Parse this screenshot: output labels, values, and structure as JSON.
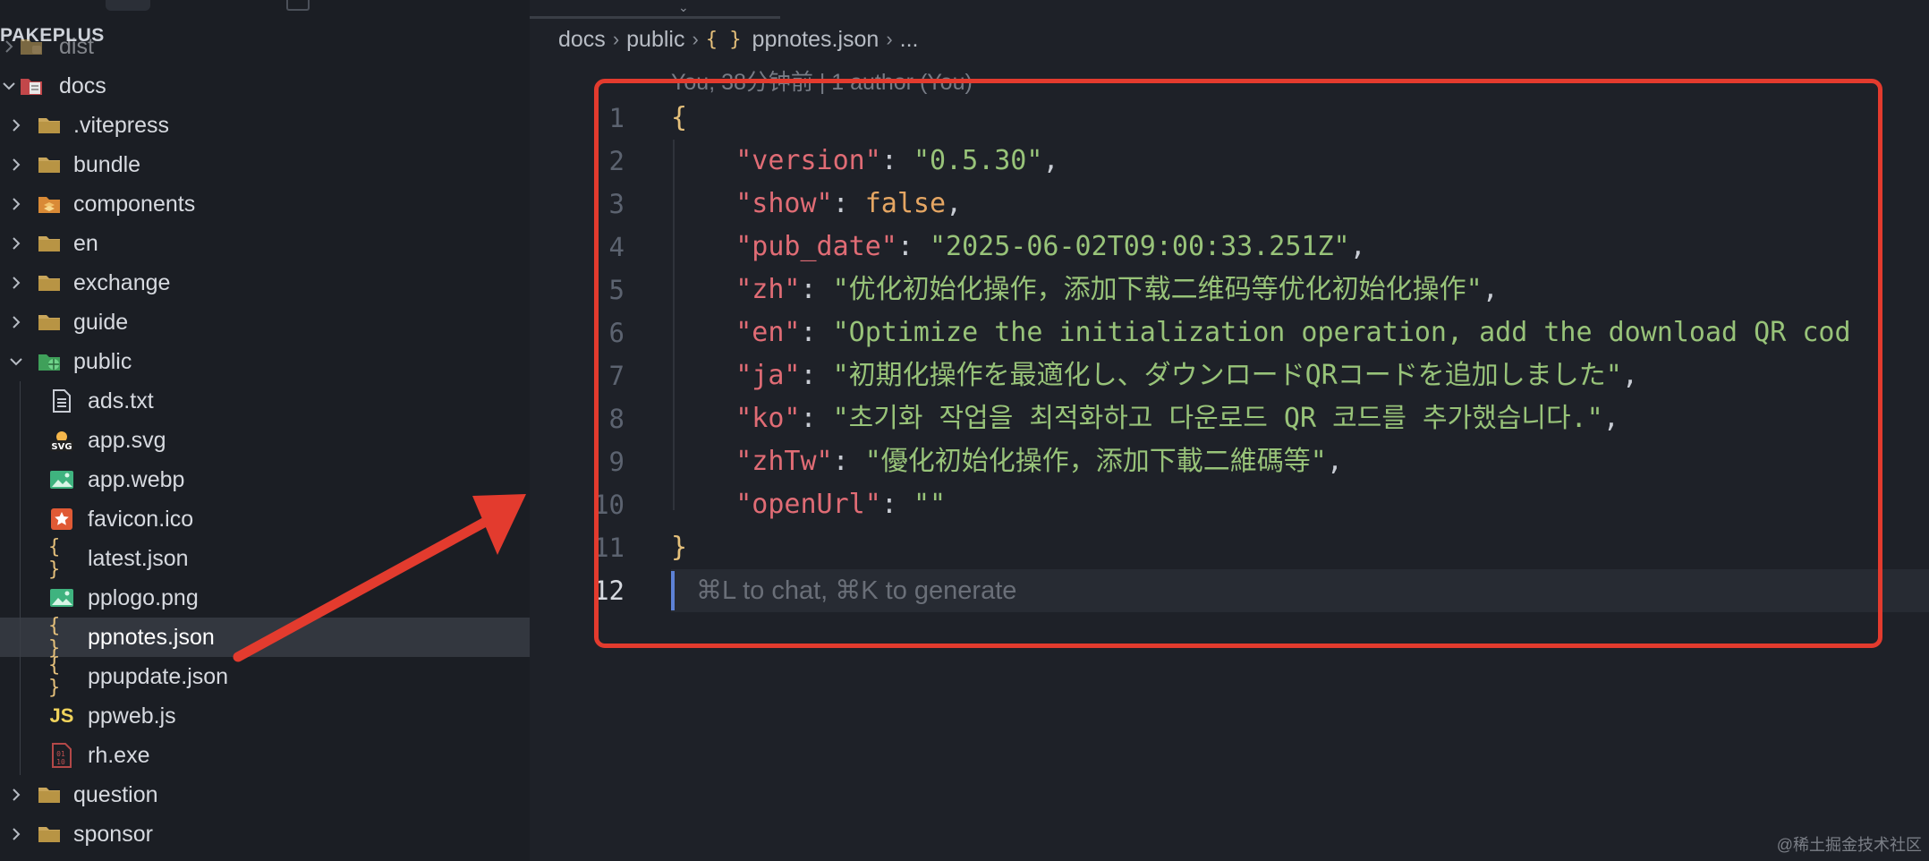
{
  "sidebar": {
    "section_title": "PAKEPLUS",
    "items": [
      {
        "label": "dist",
        "icon": "folder-dist-icon",
        "kind": "folder",
        "level": 0,
        "state": "collapsed"
      },
      {
        "label": "docs",
        "icon": "folder-docs-icon",
        "kind": "folder",
        "level": 0,
        "state": "expanded"
      },
      {
        "label": ".vitepress",
        "icon": "folder-icon",
        "kind": "folder",
        "level": 1,
        "state": "collapsed"
      },
      {
        "label": "bundle",
        "icon": "folder-icon",
        "kind": "folder",
        "level": 1,
        "state": "collapsed"
      },
      {
        "label": "components",
        "icon": "folder-components-icon",
        "kind": "folder",
        "level": 1,
        "state": "collapsed"
      },
      {
        "label": "en",
        "icon": "folder-icon",
        "kind": "folder",
        "level": 1,
        "state": "collapsed"
      },
      {
        "label": "exchange",
        "icon": "folder-icon",
        "kind": "folder",
        "level": 1,
        "state": "collapsed"
      },
      {
        "label": "guide",
        "icon": "folder-icon",
        "kind": "folder",
        "level": 1,
        "state": "collapsed"
      },
      {
        "label": "public",
        "icon": "folder-public-icon",
        "kind": "folder",
        "level": 1,
        "state": "expanded"
      },
      {
        "label": "ads.txt",
        "icon": "text-file-icon",
        "kind": "file",
        "level": 2
      },
      {
        "label": "app.svg",
        "icon": "svg-file-icon",
        "kind": "file",
        "level": 2
      },
      {
        "label": "app.webp",
        "icon": "image-file-icon",
        "kind": "file",
        "level": 2
      },
      {
        "label": "favicon.ico",
        "icon": "favicon-file-icon",
        "kind": "file",
        "level": 2
      },
      {
        "label": "latest.json",
        "icon": "json-file-icon",
        "kind": "file",
        "level": 2
      },
      {
        "label": "pplogo.png",
        "icon": "image-file-icon",
        "kind": "file",
        "level": 2
      },
      {
        "label": "ppnotes.json",
        "icon": "json-file-icon",
        "kind": "file",
        "level": 2,
        "selected": true
      },
      {
        "label": "ppupdate.json",
        "icon": "json-file-icon",
        "kind": "file",
        "level": 2
      },
      {
        "label": "ppweb.js",
        "icon": "js-file-icon",
        "kind": "file",
        "level": 2
      },
      {
        "label": "rh.exe",
        "icon": "binary-file-icon",
        "kind": "file",
        "level": 2
      },
      {
        "label": "question",
        "icon": "folder-icon",
        "kind": "folder",
        "level": 1,
        "state": "collapsed"
      },
      {
        "label": "sponsor",
        "icon": "folder-icon",
        "kind": "folder",
        "level": 1,
        "state": "collapsed"
      }
    ]
  },
  "breadcrumb": {
    "parts": [
      "docs",
      "public",
      "ppnotes.json",
      "..."
    ],
    "file_icon_glyph": "{ }"
  },
  "editor": {
    "blame": "You, 38分钟前 | 1 author (You)",
    "active_line": 12,
    "hint": "⌘L to chat, ⌘K to generate",
    "lines": [
      {
        "n": "1",
        "tokens": [
          {
            "t": "{",
            "c": "brace"
          }
        ]
      },
      {
        "n": "2",
        "tokens": [
          {
            "t": "    "
          },
          {
            "t": "\"version\"",
            "c": "key"
          },
          {
            "t": ": ",
            "c": "punc"
          },
          {
            "t": "\"0.5.30\"",
            "c": "str"
          },
          {
            "t": ",",
            "c": "punc"
          }
        ]
      },
      {
        "n": "3",
        "tokens": [
          {
            "t": "    "
          },
          {
            "t": "\"show\"",
            "c": "key"
          },
          {
            "t": ": ",
            "c": "punc"
          },
          {
            "t": "false",
            "c": "bool"
          },
          {
            "t": ",",
            "c": "punc"
          }
        ]
      },
      {
        "n": "4",
        "tokens": [
          {
            "t": "    "
          },
          {
            "t": "\"pub_date\"",
            "c": "key"
          },
          {
            "t": ": ",
            "c": "punc"
          },
          {
            "t": "\"2025-06-02T09:00:33.251Z\"",
            "c": "str"
          },
          {
            "t": ",",
            "c": "punc"
          }
        ]
      },
      {
        "n": "5",
        "tokens": [
          {
            "t": "    "
          },
          {
            "t": "\"zh\"",
            "c": "key"
          },
          {
            "t": ": ",
            "c": "punc"
          },
          {
            "t": "\"优化初始化操作，添加下载二维码等优化初始化操作\"",
            "c": "str"
          },
          {
            "t": ",",
            "c": "punc"
          }
        ]
      },
      {
        "n": "6",
        "tokens": [
          {
            "t": "    "
          },
          {
            "t": "\"en\"",
            "c": "key"
          },
          {
            "t": ": ",
            "c": "punc"
          },
          {
            "t": "\"Optimize the initialization operation, add the download QR cod",
            "c": "str"
          }
        ]
      },
      {
        "n": "7",
        "tokens": [
          {
            "t": "    "
          },
          {
            "t": "\"ja\"",
            "c": "key"
          },
          {
            "t": ": ",
            "c": "punc"
          },
          {
            "t": "\"初期化操作を最適化し、ダウンロードQRコードを追加しました\"",
            "c": "str"
          },
          {
            "t": ",",
            "c": "punc"
          }
        ]
      },
      {
        "n": "8",
        "tokens": [
          {
            "t": "    "
          },
          {
            "t": "\"ko\"",
            "c": "key"
          },
          {
            "t": ": ",
            "c": "punc"
          },
          {
            "t": "\"초기화 작업을 최적화하고 다운로드 QR 코드를 추가했습니다.\"",
            "c": "str"
          },
          {
            "t": ",",
            "c": "punc"
          }
        ]
      },
      {
        "n": "9",
        "tokens": [
          {
            "t": "    "
          },
          {
            "t": "\"zhTw\"",
            "c": "key"
          },
          {
            "t": ": ",
            "c": "punc"
          },
          {
            "t": "\"優化初始化操作，添加下載二維碼等\"",
            "c": "str"
          },
          {
            "t": ",",
            "c": "punc"
          }
        ]
      },
      {
        "n": "10",
        "tokens": [
          {
            "t": "    "
          },
          {
            "t": "\"openUrl\"",
            "c": "key"
          },
          {
            "t": ": ",
            "c": "punc"
          },
          {
            "t": "\"\"",
            "c": "str"
          }
        ]
      },
      {
        "n": "11",
        "tokens": [
          {
            "t": "}",
            "c": "brace"
          }
        ]
      },
      {
        "n": "12",
        "tokens": []
      }
    ]
  },
  "annotations": {
    "highlight_color": "#e33b2e",
    "arrow_color": "#e33b2e"
  },
  "watermark": "@稀土掘金技术社区",
  "colors": {
    "background": "#1e2128",
    "sidebar": "#1b1e24",
    "selected_row": "#33373f",
    "json_key": "#e06c75",
    "json_string": "#98c379",
    "json_bool": "#e5a663",
    "brace": "#e5c07b"
  }
}
